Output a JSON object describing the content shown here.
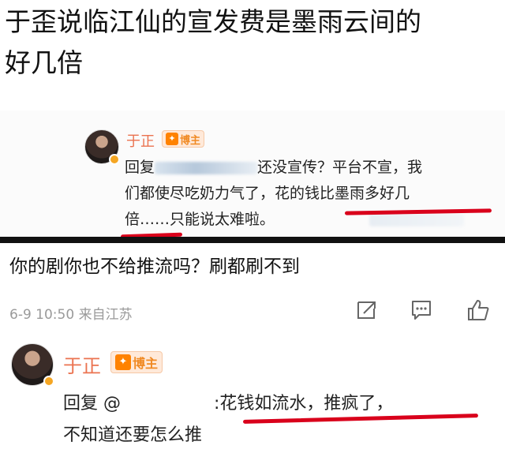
{
  "headline": {
    "line1": "于歪说临江仙的宣发费是墨雨云间的",
    "line2": "好几倍"
  },
  "upper_comment": {
    "username": "于正",
    "badge_label": "博主",
    "reply_prefix": "回复",
    "reply_text_a": "还没宣传？平台不宣，我",
    "reply_text_b": "们都使尽吃奶力气了，花的钱比墨雨多好几",
    "reply_text_c": "倍……只能说太难啦。"
  },
  "post": {
    "text": "你的剧你也不给推流吗？刷都刷不到",
    "meta": "6-9 10:50 来自江苏"
  },
  "lower_comment": {
    "username": "于正",
    "badge_label": "博主",
    "reply_prefix": "回复 @",
    "reply_text_a": ":花钱如流水，推疯了，",
    "reply_text_b": "不知道还要怎么推"
  },
  "icons": [
    "share-icon",
    "comment-icon",
    "like-icon",
    "verified-icon",
    "badge-icon"
  ],
  "colors": {
    "username": "#eb7350",
    "underline": "#d9001b",
    "divider": "#111111"
  }
}
